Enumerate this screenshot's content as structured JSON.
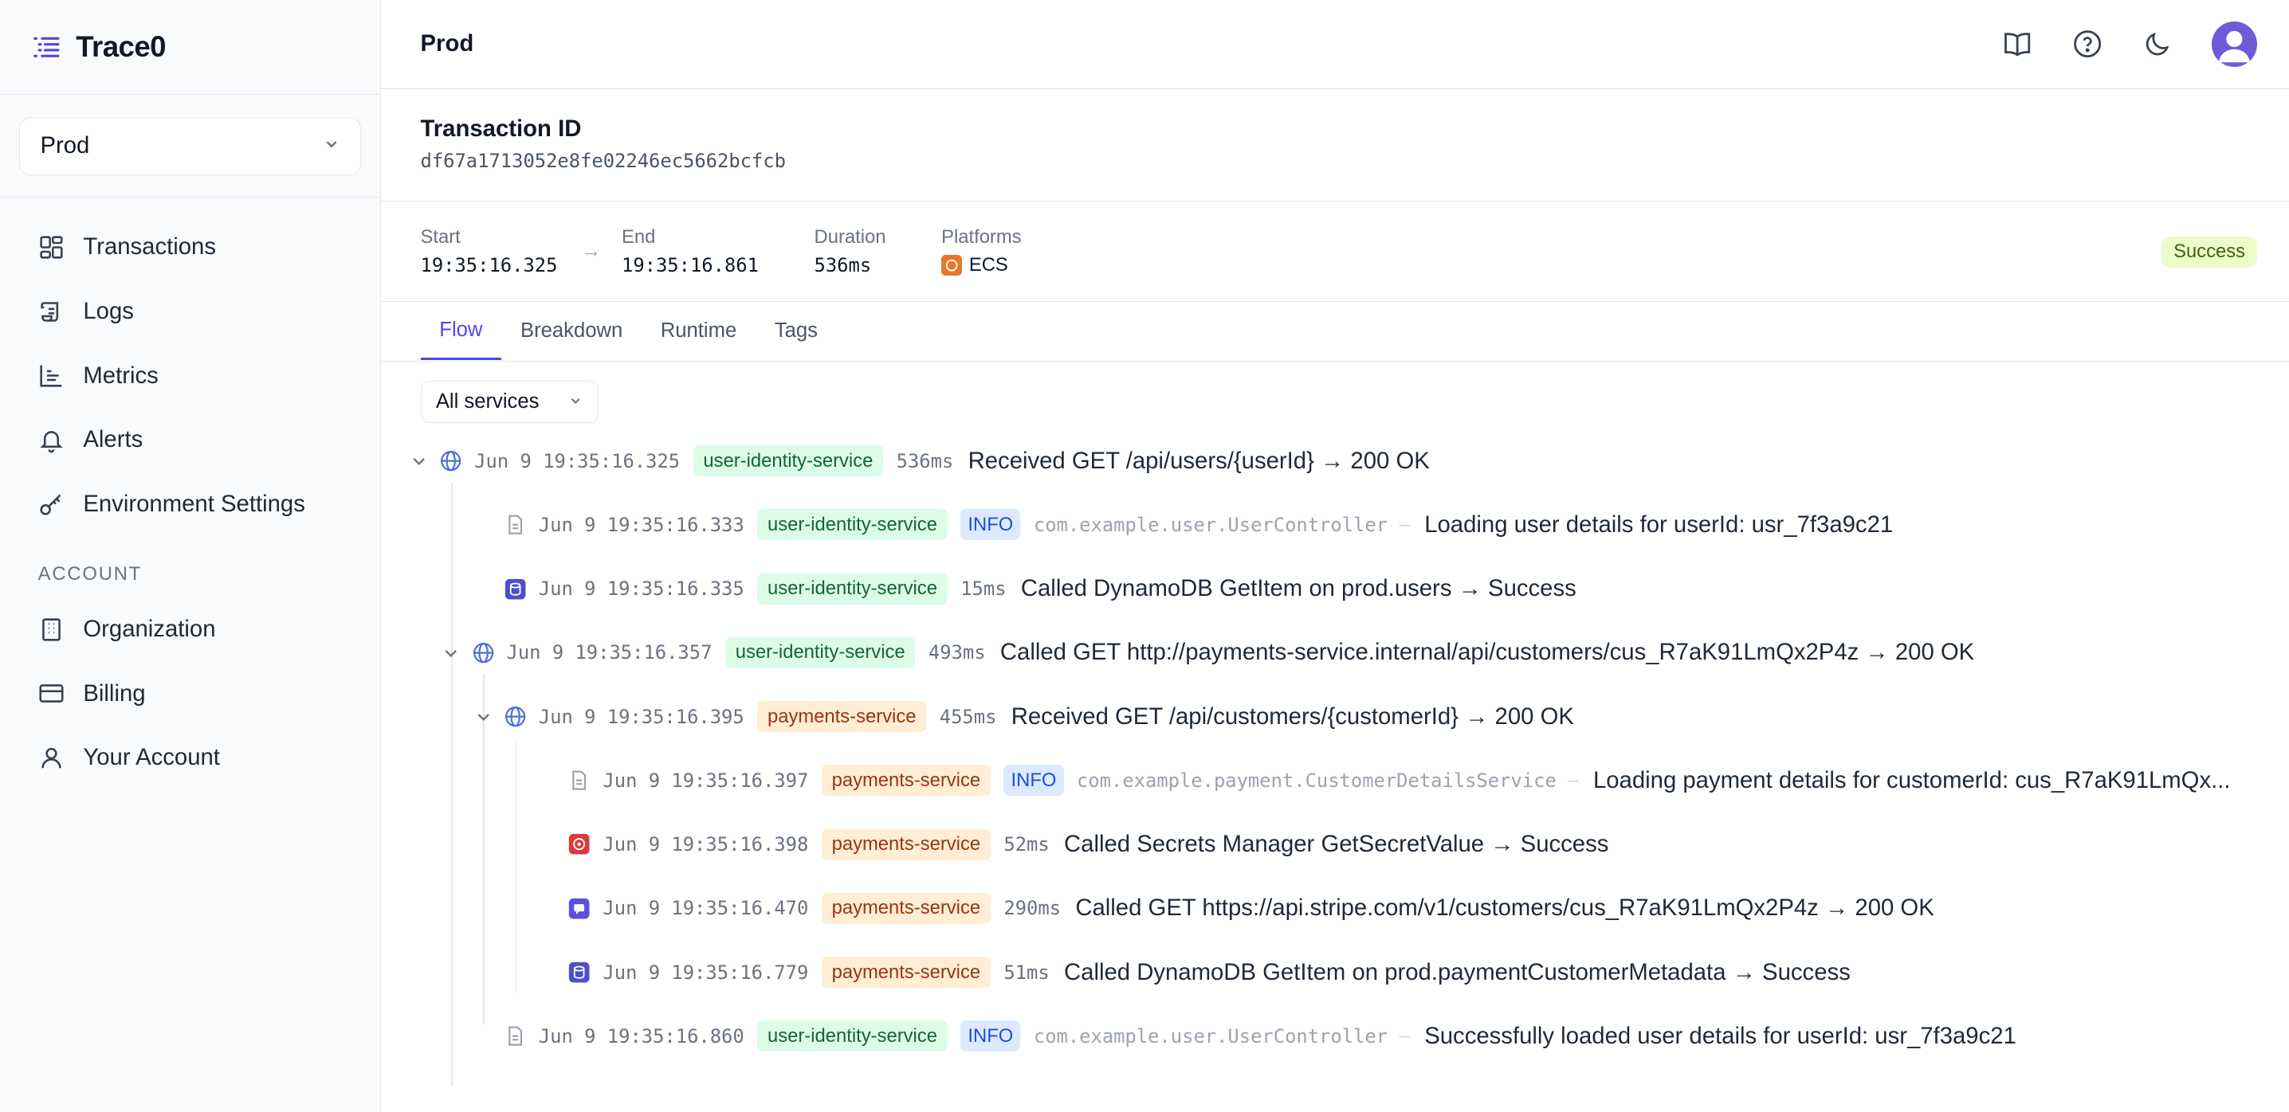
{
  "app": {
    "name": "Trace0"
  },
  "environment": {
    "selected": "Prod"
  },
  "sidebar": {
    "items": [
      {
        "label": "Transactions",
        "icon": "grid-icon"
      },
      {
        "label": "Logs",
        "icon": "scroll-icon"
      },
      {
        "label": "Metrics",
        "icon": "bar-chart-icon"
      },
      {
        "label": "Alerts",
        "icon": "bell-icon"
      },
      {
        "label": "Environment Settings",
        "icon": "key-icon"
      }
    ],
    "section_label": "ACCOUNT",
    "account_items": [
      {
        "label": "Organization",
        "icon": "building-icon"
      },
      {
        "label": "Billing",
        "icon": "credit-card-icon"
      },
      {
        "label": "Your Account",
        "icon": "user-icon"
      }
    ]
  },
  "header": {
    "title": "Prod"
  },
  "transaction": {
    "label": "Transaction ID",
    "id": "df67a1713052e8fe02246ec5662bcfcb",
    "start_label": "Start",
    "start": "19:35:16.325",
    "end_label": "End",
    "end": "19:35:16.861",
    "duration_label": "Duration",
    "duration": "536ms",
    "platforms_label": "Platforms",
    "platform": "ECS",
    "status": "Success"
  },
  "tabs": [
    "Flow",
    "Breakdown",
    "Runtime",
    "Tags"
  ],
  "active_tab": "Flow",
  "filter": {
    "label": "All services"
  },
  "colors": {
    "accent": "#4f46e5",
    "service_green": "#166534",
    "service_orange": "#9a3412",
    "info": "#1d4ed8",
    "success": "#3f6212"
  },
  "flow": [
    {
      "chevron": true,
      "icon": "globe-icon",
      "ts": "Jun 9 19:35:16.325",
      "service": "user-identity-service",
      "color": "green",
      "duration": "536ms",
      "message": "Received GET /api/users/{userId} → 200 OK"
    },
    {
      "chevron": false,
      "icon": "document-icon",
      "ts": "Jun 9 19:35:16.333",
      "service": "user-identity-service",
      "color": "green",
      "level": "INFO",
      "logger": "com.example.user.UserController",
      "sep": "–",
      "message": "Loading user details for userId: usr_7f3a9c21"
    },
    {
      "chevron": false,
      "icon": "dynamodb-icon",
      "ts": "Jun 9 19:35:16.335",
      "service": "user-identity-service",
      "color": "green",
      "duration": "15ms",
      "message": "Called DynamoDB GetItem on prod.users → Success"
    },
    {
      "chevron": true,
      "icon": "globe-icon",
      "ts": "Jun 9 19:35:16.357",
      "service": "user-identity-service",
      "color": "green",
      "duration": "493ms",
      "message": "Called GET http://payments-service.internal/api/customers/cus_R7aK91LmQx2P4z → 200 OK"
    },
    {
      "chevron": true,
      "icon": "globe-icon",
      "ts": "Jun 9 19:35:16.395",
      "service": "payments-service",
      "color": "orange",
      "duration": "455ms",
      "message": "Received GET /api/customers/{customerId} → 200 OK"
    },
    {
      "chevron": false,
      "icon": "document-icon",
      "ts": "Jun 9 19:35:16.397",
      "service": "payments-service",
      "color": "orange",
      "level": "INFO",
      "logger": "com.example.payment.CustomerDetailsService",
      "sep": "–",
      "message": "Loading payment details for customerId: cus_R7aK91LmQx..."
    },
    {
      "chevron": false,
      "icon": "secrets-manager-icon",
      "ts": "Jun 9 19:35:16.398",
      "service": "payments-service",
      "color": "orange",
      "duration": "52ms",
      "message": "Called Secrets Manager GetSecretValue → Success"
    },
    {
      "chevron": false,
      "icon": "stripe-icon",
      "ts": "Jun 9 19:35:16.470",
      "service": "payments-service",
      "color": "orange",
      "duration": "290ms",
      "message": "Called GET https://api.stripe.com/v1/customers/cus_R7aK91LmQx2P4z → 200 OK"
    },
    {
      "chevron": false,
      "icon": "dynamodb-icon",
      "ts": "Jun 9 19:35:16.779",
      "service": "payments-service",
      "color": "orange",
      "duration": "51ms",
      "message": "Called DynamoDB GetItem on prod.paymentCustomerMetadata → Success"
    },
    {
      "chevron": false,
      "icon": "document-icon",
      "ts": "Jun 9 19:35:16.860",
      "service": "user-identity-service",
      "color": "green",
      "level": "INFO",
      "logger": "com.example.user.UserController",
      "sep": "–",
      "message": "Successfully loaded user details for userId: usr_7f3a9c21"
    }
  ]
}
